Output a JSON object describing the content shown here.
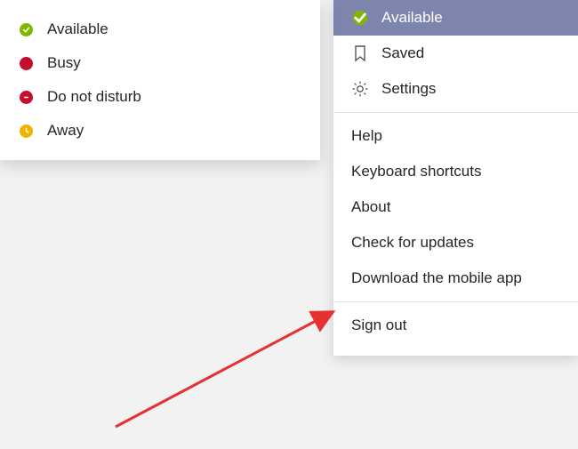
{
  "status_menu": {
    "available": "Available",
    "busy": "Busy",
    "dnd": "Do not disturb",
    "away": "Away"
  },
  "settings_menu": {
    "available": "Available",
    "saved": "Saved",
    "settings": "Settings",
    "help": "Help",
    "keyboard_shortcuts": "Keyboard shortcuts",
    "about": "About",
    "check_for_updates": "Check for updates",
    "download_mobile": "Download the mobile app",
    "sign_out": "Sign out"
  },
  "colors": {
    "highlight_bg": "#7e85ac",
    "available": "#7db700",
    "busy": "#c50e2e",
    "away": "#f0b400",
    "arrow": "#e53131"
  }
}
